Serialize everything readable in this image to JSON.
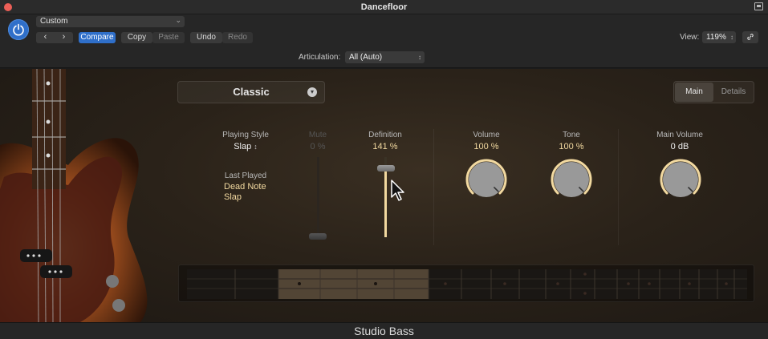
{
  "window": {
    "title": "Dancefloor"
  },
  "header": {
    "preset": "Custom",
    "compare": "Compare",
    "copy": "Copy",
    "paste": "Paste",
    "undo": "Undo",
    "redo": "Redo",
    "view_label": "View:",
    "view_value": "119%",
    "articulation_label": "Articulation:",
    "articulation_value": "All (Auto)"
  },
  "main": {
    "type": "Classic",
    "tabs": [
      "Main",
      "Details"
    ],
    "playing_style_label": "Playing Style",
    "playing_style_value": "Slap",
    "mute_label": "Mute",
    "mute_value": "0 %",
    "last_played_label": "Last Played",
    "last_played_value_1": "Dead Note",
    "last_played_value_2": "Slap",
    "definition_label": "Definition",
    "definition_value": "141 %",
    "definition_level_pct": 100,
    "volume_label": "Volume",
    "volume_value": "100 %",
    "volume_level_pct": 100,
    "tone_label": "Tone",
    "tone_value": "100 %",
    "tone_level_pct": 100,
    "main_volume_label": "Main Volume",
    "main_volume_value": "0 dB"
  },
  "footer": {
    "title": "Studio Bass"
  },
  "colors": {
    "accent_blue": "#2f6fc9",
    "knob_ring": "#f2d9a0",
    "value_text": "#f2d9a0"
  }
}
